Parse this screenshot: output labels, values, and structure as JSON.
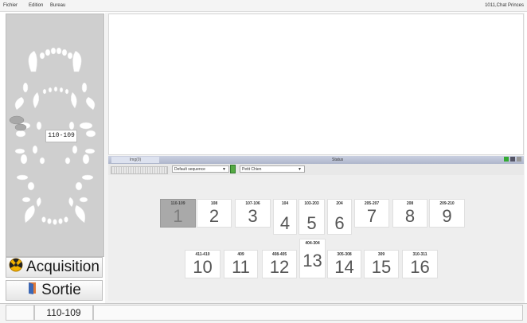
{
  "menu": {
    "items": [
      "Fichier",
      "Edition",
      "Bureau"
    ],
    "right": "1011,Chat Princes"
  },
  "chart_panel": {
    "selected_label": "110-109"
  },
  "buttons": {
    "acquisition": "Acquisition",
    "sortie": "Sortie"
  },
  "status": {
    "tab": "Img(0)",
    "title": "Status"
  },
  "toolbar": {
    "sequence": "Default sequence",
    "mode": "Petit Chien"
  },
  "tiles_row1": [
    {
      "label": "110-109",
      "number": "1",
      "active": true
    },
    {
      "label": "108",
      "number": "2"
    },
    {
      "label": "107-106",
      "number": "3"
    },
    {
      "label": "104",
      "number": "4"
    },
    {
      "label": "103-203",
      "number": "5"
    },
    {
      "label": "204",
      "number": "6"
    },
    {
      "label": "205-207",
      "number": "7"
    },
    {
      "label": "208",
      "number": "8"
    },
    {
      "label": "209-210",
      "number": "9"
    }
  ],
  "tiles_row2": [
    {
      "label": "411-410",
      "number": "10"
    },
    {
      "label": "409",
      "number": "11"
    },
    {
      "label": "408-405",
      "number": "12"
    },
    {
      "label": "404-304",
      "number": "13"
    },
    {
      "label": "305-308",
      "number": "14"
    },
    {
      "label": "309",
      "number": "15"
    },
    {
      "label": "310-311",
      "number": "16"
    }
  ],
  "bottom": {
    "current": "110-109"
  },
  "colors": {
    "active_tile": "#a9a9a9",
    "panel": "#cfcfcf",
    "statusbar": "#b8bfd4"
  }
}
